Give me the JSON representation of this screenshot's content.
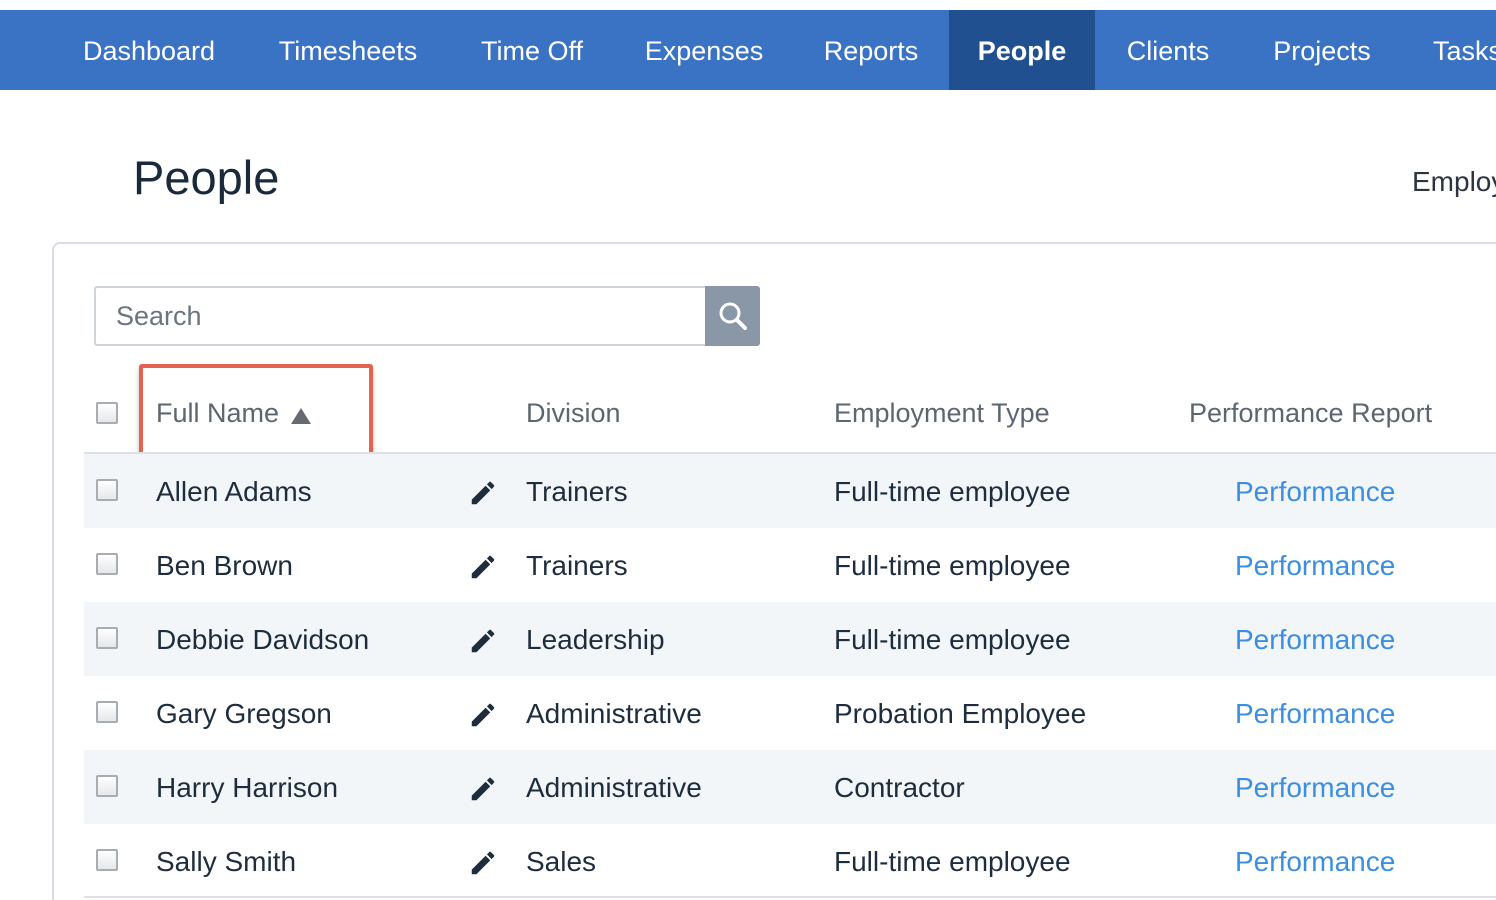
{
  "nav": {
    "items": [
      {
        "label": "Dashboard",
        "active": false
      },
      {
        "label": "Timesheets",
        "active": false
      },
      {
        "label": "Time Off",
        "active": false
      },
      {
        "label": "Expenses",
        "active": false
      },
      {
        "label": "Reports",
        "active": false
      },
      {
        "label": "People",
        "active": true
      },
      {
        "label": "Clients",
        "active": false
      },
      {
        "label": "Projects",
        "active": false
      },
      {
        "label": "Tasks",
        "active": false
      }
    ]
  },
  "page": {
    "title": "People",
    "right_label": "Employ"
  },
  "search": {
    "placeholder": "Search",
    "icon": "search-icon"
  },
  "table": {
    "columns": [
      "Full Name",
      "Division",
      "Employment Type",
      "Performance Report"
    ],
    "sort": {
      "column": "Full Name",
      "direction": "ascending",
      "icon": "triangle-up-icon"
    },
    "rows": [
      {
        "name": "Allen Adams",
        "division": "Trainers",
        "employment_type": "Full-time employee",
        "report": "Performance"
      },
      {
        "name": "Ben Brown",
        "division": "Trainers",
        "employment_type": "Full-time employee",
        "report": "Performance"
      },
      {
        "name": "Debbie Davidson",
        "division": "Leadership",
        "employment_type": "Full-time employee",
        "report": "Performance"
      },
      {
        "name": "Gary Gregson",
        "division": "Administrative",
        "employment_type": "Probation Employee",
        "report": "Performance"
      },
      {
        "name": "Harry Harrison",
        "division": "Administrative",
        "employment_type": "Contractor",
        "report": "Performance"
      },
      {
        "name": "Sally Smith",
        "division": "Sales",
        "employment_type": "Full-time employee",
        "report": "Performance"
      }
    ]
  },
  "colors": {
    "nav_bg": "#3a72c4",
    "nav_active_bg": "#20508f",
    "link": "#3b8ee0",
    "highlight": "#e06450"
  }
}
